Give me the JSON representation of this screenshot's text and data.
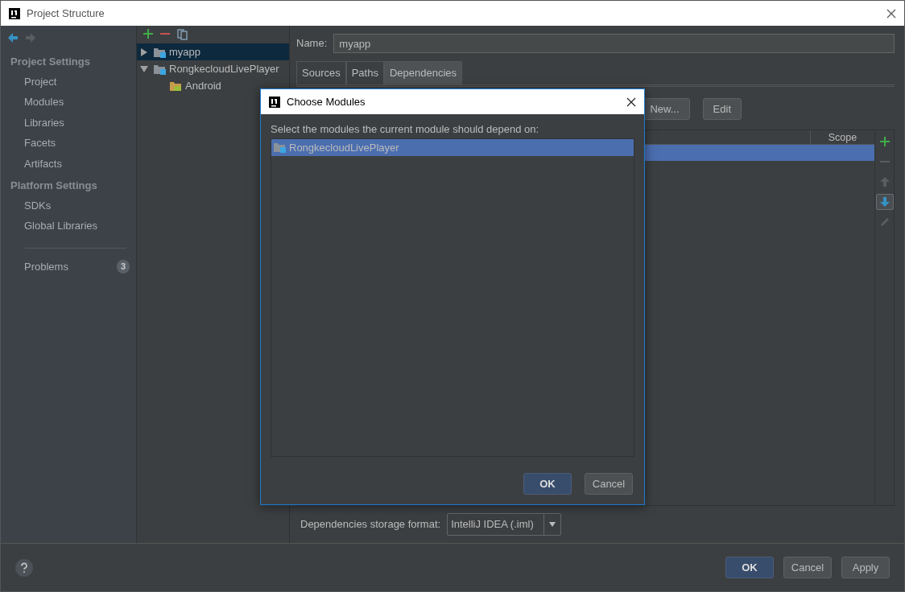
{
  "window": {
    "title": "Project Structure"
  },
  "nav": [
    {
      "kind": "back",
      "disabled": false
    },
    {
      "kind": "forward",
      "disabled": true
    }
  ],
  "sidebar": {
    "sections": [
      {
        "title": "Project Settings",
        "items": [
          {
            "label": "Project",
            "selected": false
          },
          {
            "label": "Modules",
            "selected": false
          },
          {
            "label": "Libraries",
            "selected": false
          },
          {
            "label": "Facets",
            "selected": false
          },
          {
            "label": "Artifacts",
            "selected": false
          }
        ]
      },
      {
        "title": "Platform Settings",
        "items": [
          {
            "label": "SDKs",
            "selected": false
          },
          {
            "label": "Global Libraries",
            "selected": false
          }
        ]
      }
    ],
    "problems": {
      "label": "Problems",
      "count": "3"
    }
  },
  "tree": {
    "toolbar": [
      {
        "kind": "add"
      },
      {
        "kind": "remove"
      },
      {
        "kind": "copy"
      }
    ],
    "items": [
      {
        "label": "myapp",
        "kind": "module",
        "selected": true,
        "expanded": false
      },
      {
        "label": "RongkecloudLivePlayer",
        "kind": "module",
        "selected": false,
        "expanded": true,
        "children": [
          {
            "label": "Android",
            "kind": "android",
            "selected": false
          }
        ]
      }
    ]
  },
  "module": {
    "name_label": "Name:",
    "name": "myapp",
    "tabs": [
      {
        "label": "Sources",
        "selected": false
      },
      {
        "label": "Paths",
        "selected": false
      },
      {
        "label": "Dependencies",
        "selected": true
      }
    ],
    "actions": [
      "New...",
      "Edit"
    ],
    "table": {
      "columns": [
        "Scope"
      ],
      "rows": [
        {
          "selected": true
        }
      ]
    },
    "side_tools": [
      {
        "kind": "add",
        "disabled": false,
        "pressed": false
      },
      {
        "kind": "remove",
        "disabled": true,
        "pressed": false
      },
      {
        "kind": "up",
        "disabled": true,
        "pressed": false
      },
      {
        "kind": "down",
        "disabled": false,
        "pressed": true
      },
      {
        "kind": "edit",
        "disabled": true,
        "pressed": false
      }
    ],
    "storage": {
      "label": "Dependencies storage format:",
      "value": "IntelliJ IDEA (.iml)"
    }
  },
  "buttons": [
    {
      "label": "OK",
      "default": true
    },
    {
      "label": "Cancel",
      "default": false
    },
    {
      "label": "Apply",
      "default": false
    }
  ],
  "dialog": {
    "title": "Choose Modules",
    "prompt": "Select the modules the current module should depend on:",
    "items": [
      {
        "label": "RongkecloudLivePlayer",
        "selected": true
      }
    ],
    "buttons": [
      {
        "label": "OK",
        "default": true
      },
      {
        "label": "Cancel",
        "default": false
      }
    ]
  }
}
